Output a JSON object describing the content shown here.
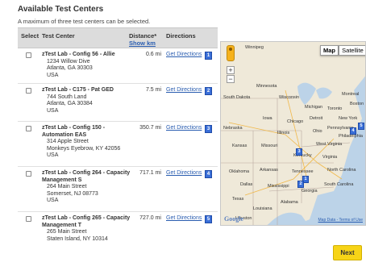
{
  "page": {
    "title": "Available Test Centers",
    "subtitle": "A maximum of three test centers can be selected."
  },
  "table": {
    "headers": {
      "select": "Select",
      "center": "Test Center",
      "distance": "Distance*",
      "show_km": "Show km",
      "directions": "Directions"
    },
    "rows": [
      {
        "name": "zTest Lab - Config 56 - Allie",
        "address": [
          "1234 Willow Dive",
          "Atlanta, GA 30303",
          "USA"
        ],
        "distance": "0.6 mi",
        "directions": "Get Directions",
        "marker": "1"
      },
      {
        "name": "zTest Lab - C175 - Pat GED",
        "address": [
          "744 South Land",
          "Atlanta, GA 30384",
          "USA"
        ],
        "distance": "7.5 mi",
        "directions": "Get Directions",
        "marker": "2"
      },
      {
        "name": "zTest Lab - Config 150 - Automation EAS",
        "address": [
          "314 Apple Street",
          "Monkeys Eyebrow, KY 42056",
          "USA"
        ],
        "distance": "350.7 mi",
        "directions": "Get Directions",
        "marker": "3"
      },
      {
        "name": "zTest Lab - Config 264 - Capacity Management S",
        "address": [
          "264 Main Street",
          "Somerset, NJ 08773",
          "USA"
        ],
        "distance": "717.1 mi",
        "directions": "Get Directions",
        "marker": "4"
      },
      {
        "name": "zTest Lab - Config 265 - Capacity Management T",
        "address": [
          "265 Main Street",
          "Staten Island, NY 10314"
        ],
        "distance": "727.0 mi",
        "directions": "Get Directions",
        "marker": "5"
      }
    ]
  },
  "map": {
    "map_button": "Map",
    "satellite_button": "Satellite",
    "zoom_in": "+",
    "zoom_out": "−",
    "labels": [
      "Winnipeg",
      "Minnesota",
      "South Dakota",
      "Wisconsin",
      "Michigan",
      "Toronto",
      "Iowa",
      "Chicago",
      "Detroit",
      "New York",
      "Nebraska",
      "Illinois",
      "Ohio",
      "Pennsylvania",
      "Kansas",
      "Missouri",
      "West Virginia",
      "Kentucky",
      "Virginia",
      "Oklahoma",
      "Arkansas",
      "Tennessee",
      "North Carolina",
      "Dallas",
      "Mississippi",
      "Georgia",
      "South Carolina",
      "Texas",
      "Alabama",
      "Louisiana",
      "Houston",
      "Montreal",
      "Boston",
      "Philadelphia"
    ],
    "markers": [
      "1",
      "2",
      "3",
      "4",
      "5"
    ],
    "google": "Google",
    "map_data": "Map Data - Terms of Use",
    "colors": {
      "water": "#bcd3e8",
      "land": "#efe9d9",
      "marker": "#3a6fd8"
    }
  },
  "actions": {
    "next": "Next"
  }
}
